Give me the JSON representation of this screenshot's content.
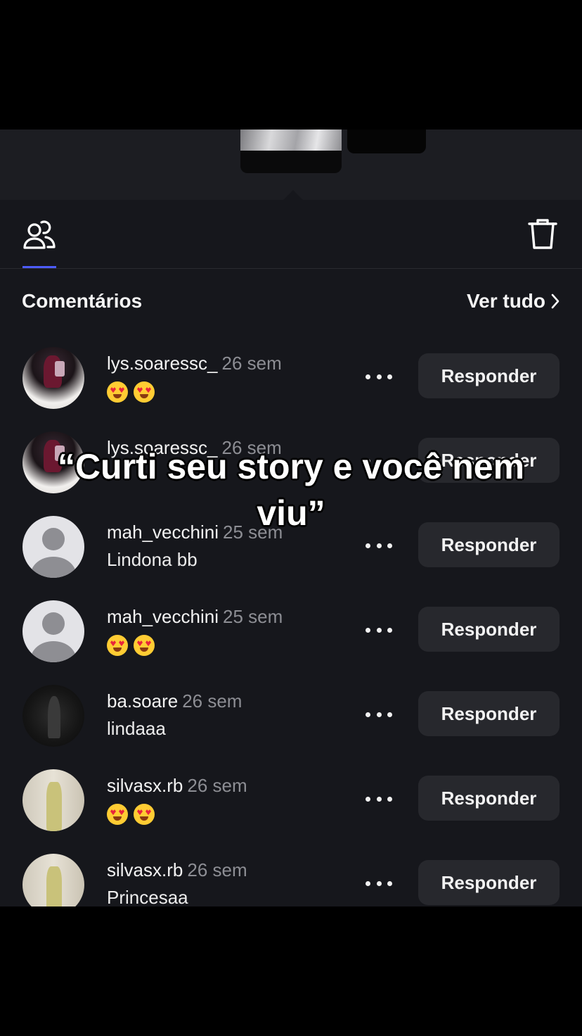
{
  "tabs": {
    "viewers_icon": "people-icon",
    "delete_icon": "trash-icon"
  },
  "section": {
    "title": "Comentários",
    "see_all": "Ver tudo"
  },
  "comments": [
    {
      "username": "lys.soaressc_",
      "time": "26 sem",
      "text": "😍😍",
      "emoji_count": 2,
      "reply": "Responder"
    },
    {
      "username": "lys.soaressc_",
      "time": "26 sem",
      "text": "",
      "reply": "Responder"
    },
    {
      "username": "mah_vecchini",
      "time": "25 sem",
      "text": "Lindona bb",
      "reply": "Responder"
    },
    {
      "username": "mah_vecchini",
      "time": "25 sem",
      "text": "😍😍",
      "emoji_count": 2,
      "reply": "Responder"
    },
    {
      "username": "ba.soare",
      "time": "26 sem",
      "text": "lindaaa",
      "reply": "Responder"
    },
    {
      "username": "silvasx.rb",
      "time": "26 sem",
      "text": "😍😍",
      "emoji_count": 2,
      "reply": "Responder"
    },
    {
      "username": "silvasx.rb",
      "time": "26 sem",
      "text": "Princesaa",
      "reply": "Responder"
    }
  ],
  "overlay": {
    "caption": "“Curti seu story e você nem viu”"
  },
  "colors": {
    "background": "#16171c",
    "button": "#27282d",
    "accent": "#4d5cff",
    "muted": "#8d8e94"
  }
}
